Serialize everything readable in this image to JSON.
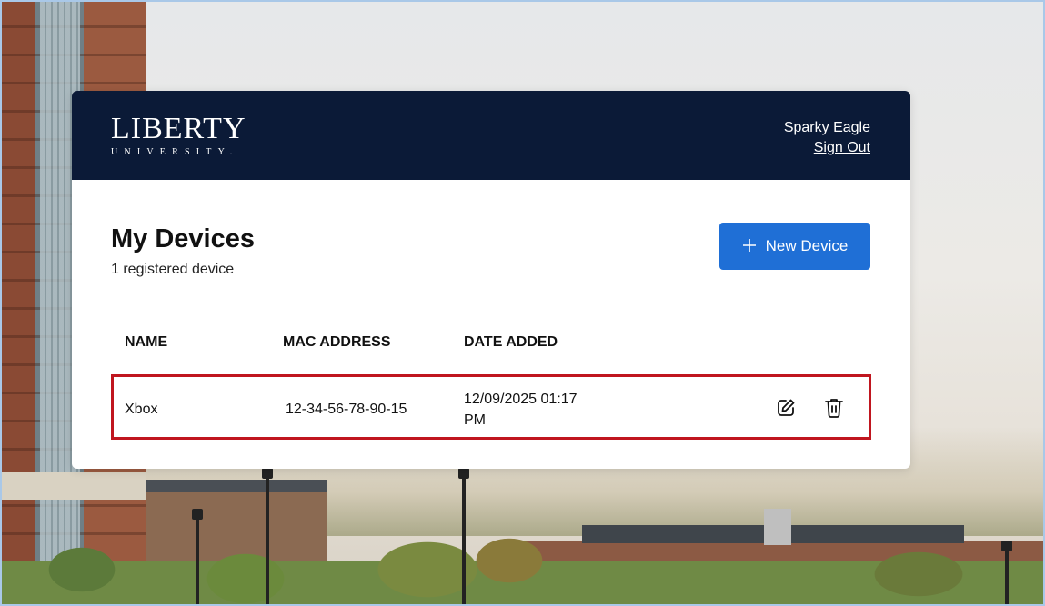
{
  "header": {
    "logo_main": "LIBERTY",
    "logo_sub": "UNIVERSITY.",
    "user_name": "Sparky Eagle",
    "sign_out": "Sign Out"
  },
  "page": {
    "title": "My Devices",
    "subtitle": "1 registered device",
    "new_device_label": "New Device",
    "new_device_icon": "plus-icon"
  },
  "table": {
    "columns": [
      "NAME",
      "MAC ADDRESS",
      "DATE ADDED"
    ],
    "rows": [
      {
        "name": "Xbox",
        "mac": "12-34-56-78-90-15",
        "date_line1": "12/09/2025 01:17",
        "date_line2": "PM",
        "actions": [
          "edit-icon",
          "trash-icon"
        ]
      }
    ]
  },
  "colors": {
    "header_bg": "#0b1a37",
    "primary_button": "#1f6fd6",
    "highlight_border": "#c0161f"
  }
}
